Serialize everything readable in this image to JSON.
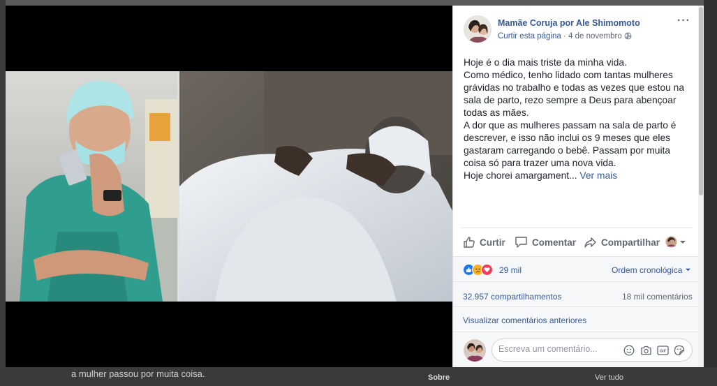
{
  "background": {
    "text_bottom": "a mulher passou por muita coisa.",
    "sobre": "Sobre",
    "ver_tudo": "Ver tudo"
  },
  "post": {
    "page_name": "Mamãe Coruja por Ale Shimomoto",
    "like_page": "Curtir esta página",
    "separator": " · ",
    "date": "4 de novembro",
    "more": "···",
    "body_lines": [
      "Hoje é o dia mais triste da minha vida.",
      "Como médico, tenho lidado com tantas mulheres grávidas no trabalho e todas as vezes que estou na sala de parto, rezo sempre a Deus para abençoar todas as mães.",
      "A dor que as mulheres passam na sala de parto é descrever, e isso não inclui os 9 meses que eles gastaram carregando o bebê. Passam por muita coisa só para trazer uma nova vida."
    ],
    "truncated_line": "Hoje chorei amargament...",
    "see_more": "Ver mais"
  },
  "actions": {
    "like": "Curtir",
    "comment": "Comentar",
    "share": "Compartilhar"
  },
  "reactions": {
    "count": "29 mil",
    "order": "Ordem cronológica"
  },
  "stats": {
    "shares": "32.957 compartilhamentos",
    "comments": "18 mil comentários"
  },
  "previous_comments": "Visualizar comentários anteriores",
  "composer": {
    "placeholder": "Escreva um comentário..."
  },
  "colors": {
    "link": "#365899",
    "like_blue": "#1877f2",
    "love_red": "#f33e58",
    "haha_yellow": "#f7b125"
  }
}
